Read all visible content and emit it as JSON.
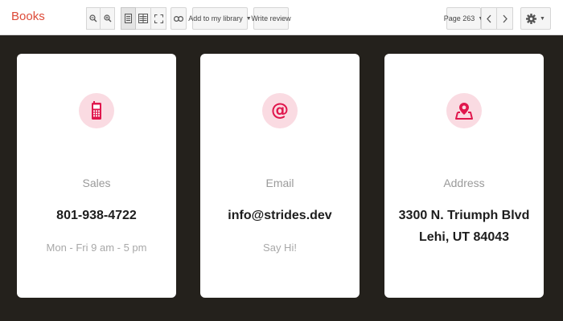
{
  "toolbar": {
    "brand": "Books",
    "zoom_out_icon": "zoom-out-icon",
    "zoom_in_icon": "zoom-in-icon",
    "single_page_icon": "single-page-icon",
    "two_page_icon": "two-page-icon",
    "fullscreen_icon": "fullscreen-icon",
    "link_icon": "link-icon",
    "add_to_library_label": "Add to my library",
    "write_review_label": "Write review",
    "page_label": "Page 263",
    "settings_icon": "gear-icon"
  },
  "cards": [
    {
      "icon": "phone-icon",
      "label": "Sales",
      "value": "801-938-4722",
      "value_line2": "",
      "sub": "Mon - Fri 9 am - 5 pm"
    },
    {
      "icon": "at-sign-icon",
      "label": "Email",
      "value": "info@strides.dev",
      "value_line2": "",
      "sub": "Say Hi!"
    },
    {
      "icon": "map-pin-icon",
      "label": "Address",
      "value": "3300 N. Triumph Blvd",
      "value_line2": "Lehi, UT 84043",
      "sub": ""
    }
  ],
  "colors": {
    "brand": "#dd4b39",
    "accent": "#e0174d",
    "icon_bg": "#fadbe2",
    "page_bg": "#24211c"
  }
}
